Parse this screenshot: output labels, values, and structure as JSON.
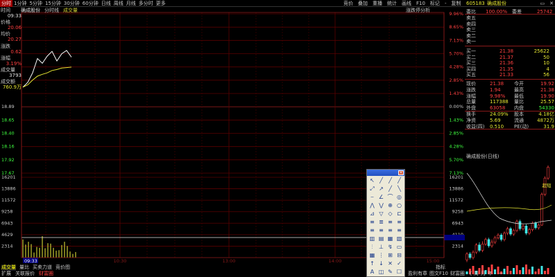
{
  "topbar": {
    "tabs": [
      "分时",
      "1分钟",
      "5分钟",
      "15分钟",
      "30分钟",
      "60分钟",
      "日线",
      "周线",
      "月线",
      "多分时",
      "更多"
    ],
    "active_index": 0,
    "right_menu": [
      "竞价",
      "叠加",
      "重播",
      "统计",
      "画线",
      "F10",
      "标记",
      "-",
      "复制"
    ]
  },
  "info": {
    "stock": "确成股份",
    "mode": "分时线",
    "volume": "成交量",
    "analysis": "涨跌停分析"
  },
  "left": {
    "time_label": "时间",
    "time": "09:33",
    "price_label": "价格",
    "price": "20.06",
    "avg_label": "均价",
    "avg": "20.27",
    "chg_label": "涨跌",
    "chg": "0.62",
    "pct_label": "涨幅",
    "pct": "3.19%",
    "vol_label": "成交量",
    "vol": "3793",
    "amt_label": "成交额",
    "amt": "760.9万"
  },
  "price_axis": {
    "left": [
      "20.54",
      "20.06",
      "20.27",
      "19.85",
      "19.62",
      "19.38",
      "19.14",
      "18.89",
      "18.65",
      "18.40",
      "18.16",
      "17.92",
      "17.67"
    ],
    "right": [
      "9.96%",
      "8.65%",
      "7.13%",
      "5.70%",
      "4.28%",
      "2.85%",
      "1.43%",
      "0.00%",
      "1.43%",
      "2.85%",
      "4.28%",
      "5.70%",
      "7.13%"
    ]
  },
  "vol_axis": {
    "left": [
      "16201",
      "13886",
      "11572",
      "9258",
      "6943",
      "4629",
      "2314"
    ],
    "right": [
      "16201",
      "13886",
      "11572",
      "9258",
      "6943",
      "4110",
      "2314"
    ]
  },
  "time_axis": [
    "09:33",
    "10:30",
    "13:00",
    "14:00",
    "15:00"
  ],
  "chart_data": {
    "type": "line",
    "price_line": [
      19.85,
      19.95,
      20.15,
      20.45,
      20.35,
      20.5,
      20.6,
      20.4,
      20.55,
      20.62,
      20.48
    ],
    "avg_line": [
      19.85,
      19.9,
      20.0,
      20.08,
      20.12,
      20.15,
      20.2,
      20.22,
      20.25,
      20.26,
      20.27
    ],
    "volumes": [
      3900,
      2800,
      3400,
      2900,
      1100,
      2300,
      2100,
      4600,
      2000,
      3100,
      3000,
      2100,
      1500,
      1600,
      2700,
      3400,
      2500,
      1300,
      800,
      1200
    ]
  },
  "quote": {
    "code": "605183",
    "name": "确成股份",
    "wb_label": "委比",
    "wb": "100.00%",
    "wc_label": "委差",
    "wc": "25742",
    "asks": [
      {
        "label": "卖五",
        "price": "",
        "vol": ""
      },
      {
        "label": "卖四",
        "price": "",
        "vol": ""
      },
      {
        "label": "卖三",
        "price": "",
        "vol": ""
      },
      {
        "label": "卖二",
        "price": "",
        "vol": ""
      },
      {
        "label": "卖一",
        "price": "",
        "vol": ""
      }
    ],
    "bids": [
      {
        "label": "买一",
        "price": "21.38",
        "vol": "25622"
      },
      {
        "label": "买二",
        "price": "21.37",
        "vol": "50"
      },
      {
        "label": "买三",
        "price": "21.36",
        "vol": "10"
      },
      {
        "label": "买四",
        "price": "21.35",
        "vol": "4"
      },
      {
        "label": "买五",
        "price": "21.33",
        "vol": "56"
      }
    ],
    "stats": [
      {
        "a": "现价",
        "av": "21.38",
        "b": "今开",
        "bv": "19.92"
      },
      {
        "a": "涨跌",
        "av": "1.94",
        "b": "最高",
        "bv": "21.38"
      },
      {
        "a": "涨幅",
        "av": "9.98%",
        "b": "最低",
        "bv": "19.90"
      },
      {
        "a": "总量",
        "av": "117388",
        "b": "量比",
        "bv": "25.57"
      },
      {
        "a": "外盘",
        "av": "63058",
        "b": "内盘",
        "bv": "54330"
      },
      {
        "a": "换手",
        "av": "24.09%",
        "b": "股本",
        "bv": "4.18亿"
      },
      {
        "a": "净资",
        "av": "5.69",
        "b": "流通",
        "bv": "4872万"
      },
      {
        "a": "收益(四)",
        "av": "0.510",
        "b": "PE(动)",
        "bv": "31.9"
      }
    ],
    "mini_title": "确成股份(日线)",
    "chaoduan": "超短"
  },
  "bottom1": [
    "成交量",
    "量比",
    "买卖力道",
    "竞价图"
  ],
  "bottom1_active": 0,
  "bottom1_right": "指标",
  "bottom2": [
    "扩展",
    "关联报价",
    "财富圈"
  ],
  "bottom2_right": [
    "盈利有章",
    "图文F10",
    "财富圈",
    "《",
    "周",
    "月",
    "年",
    "-",
    "一"
  ],
  "colors": {
    "up": "#ff4040",
    "down": "#40ff40",
    "avg": "#e6e632",
    "grid": "#5a0000",
    "white_line": "#e0e0e0"
  }
}
